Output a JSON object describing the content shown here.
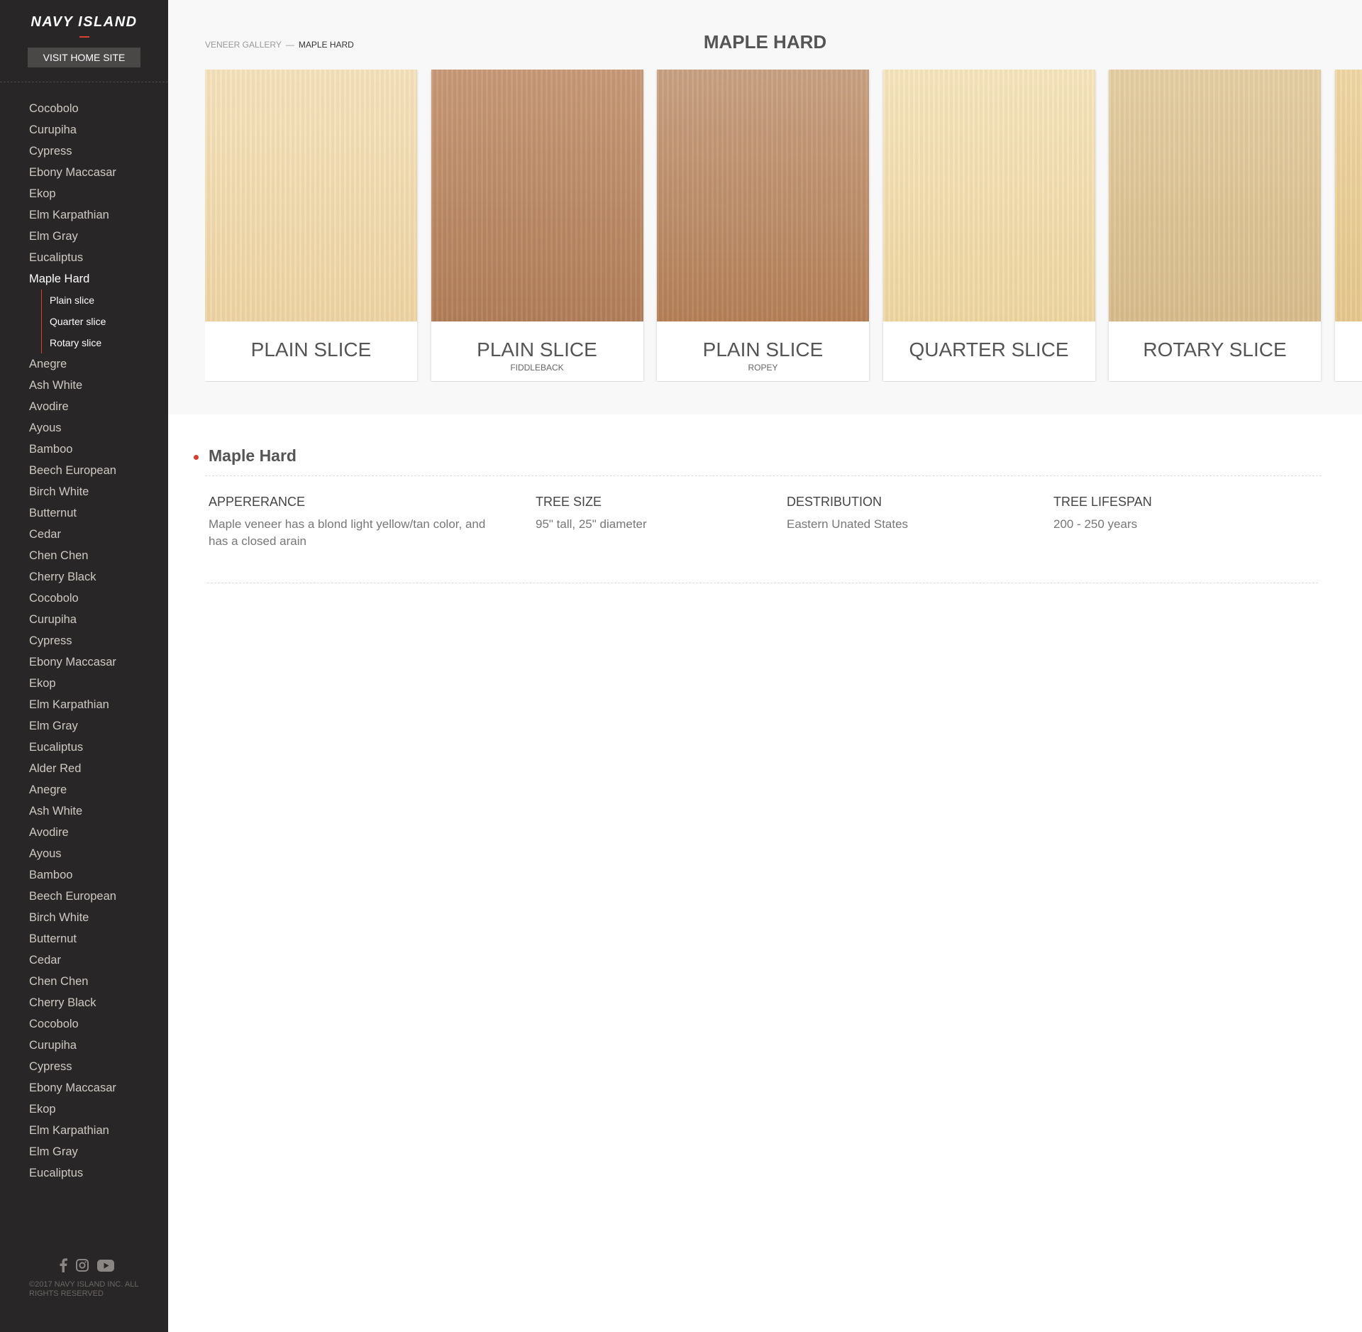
{
  "brand": {
    "logo": "NAVY ISLAND",
    "home_button": "VISIT HOME SITE"
  },
  "sidebar": {
    "items_before": [
      "Cocobolo",
      "Curupiha",
      "Cypress",
      "Ebony Maccasar",
      "Ekop",
      "Elm Karpathian",
      "Elm Gray",
      "Eucaliptus"
    ],
    "active_item": "Maple Hard",
    "sub_items": [
      "Plain slice",
      "Quarter slice",
      "Rotary slice"
    ],
    "items_after": [
      "Anegre",
      "Ash White",
      "Avodire",
      "Ayous",
      "Bamboo",
      "Beech European",
      "Birch White",
      "Butternut",
      "Cedar",
      "Chen Chen",
      "Cherry Black",
      "Cocobolo",
      "Curupiha",
      "Cypress",
      "Ebony Maccasar",
      "Ekop",
      "Elm Karpathian",
      "Elm Gray",
      "Eucaliptus",
      "Alder Red",
      "Anegre",
      "Ash White",
      "Avodire",
      "Ayous",
      "Bamboo",
      "Beech European",
      "Birch White",
      "Butternut",
      "Cedar",
      "Chen Chen",
      "Cherry Black",
      "Cocobolo",
      "Curupiha",
      "Cypress",
      "Ebony Maccasar",
      "Ekop",
      "Elm Karpathian",
      "Elm Gray",
      "Eucaliptus"
    ],
    "social_icons": [
      "facebook-icon",
      "instagram-icon",
      "youtube-icon"
    ],
    "copyright": "©2017 NAVY ISLAND INC. ALL RIGHTS RESERVED"
  },
  "breadcrumb": {
    "root": "VENEER GALLERY",
    "separator": "—",
    "current": "MAPLE HARD"
  },
  "page_title": "MAPLE HARD",
  "cards": [
    {
      "name": "PLAIN SLICE",
      "sub": "",
      "color_top": "#f6e3bd",
      "color_bottom": "#efd5a4"
    },
    {
      "name": "PLAIN SLICE",
      "sub": "FIDDLEBACK",
      "color_top": "#c89a78",
      "color_bottom": "#b27e59"
    },
    {
      "name": "PLAIN SLICE",
      "sub": "ROPEY",
      "color_top": "#c9a283",
      "color_bottom": "#b58058"
    },
    {
      "name": "QUARTER SLICE",
      "sub": "",
      "color_top": "#f7e6be",
      "color_bottom": "#efd7a2"
    },
    {
      "name": "ROTARY SLICE",
      "sub": "",
      "color_top": "#e6cfa4",
      "color_bottom": "#d8bd8c"
    },
    {
      "name": "",
      "sub": "",
      "color_top": "#f0d7a5",
      "color_bottom": "#e6c88e"
    }
  ],
  "details": {
    "title": "Maple Hard",
    "columns": [
      {
        "label": "APPERERANCE",
        "value": "Maple veneer has a blond light yellow/tan color, and has a closed arain"
      },
      {
        "label": "TREE SIZE",
        "value": "95\" tall, 25\" diameter"
      },
      {
        "label": "DESTRIBUTION",
        "value": "Eastern Unated States"
      },
      {
        "label": "TREE LIFESPAN",
        "value": "200 - 250 years"
      }
    ]
  },
  "colors": {
    "sidebar_bg": "#282626",
    "accent": "#d8402f",
    "top_panel_bg": "#f8f8f8"
  }
}
